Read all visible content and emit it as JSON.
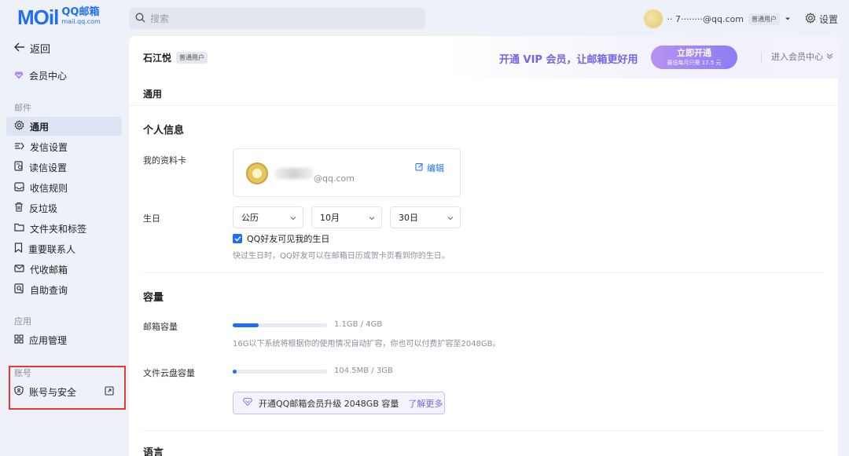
{
  "brand": {
    "wordmark": "MOil",
    "name_cn": "QQ邮箱",
    "domain": "mail.qq.com"
  },
  "search": {
    "placeholder": "搜索"
  },
  "user": {
    "email": "·· 7········@qq.com",
    "badge": "普通用户",
    "settings_label": "设置"
  },
  "sidebar": {
    "back_label": "返回",
    "vip_center_label": "会员中心",
    "section_mail": "邮件",
    "mail_items": [
      {
        "label": "通用",
        "icon": "gear-icon",
        "active": true
      },
      {
        "label": "发信设置",
        "icon": "compose-icon",
        "active": false
      },
      {
        "label": "读信设置",
        "icon": "read-icon",
        "active": false
      },
      {
        "label": "收信规则",
        "icon": "inbox-icon",
        "active": false
      },
      {
        "label": "反垃圾",
        "icon": "trash-icon",
        "active": false
      },
      {
        "label": "文件夹和标签",
        "icon": "folder-icon",
        "active": false
      },
      {
        "label": "重要联系人",
        "icon": "bookmark-icon",
        "active": false
      },
      {
        "label": "代收邮箱",
        "icon": "collect-icon",
        "active": false
      },
      {
        "label": "自助查询",
        "icon": "query-icon",
        "active": false
      }
    ],
    "section_apps": "应用",
    "apps_item": {
      "label": "应用管理",
      "icon": "grid-icon"
    },
    "section_account": "账号",
    "account_item": {
      "label": "账号与安全",
      "icon": "shield-icon"
    }
  },
  "header": {
    "username": "石江悦",
    "user_badge": "普通用户",
    "vip_pitch": "开通 VIP 会员，让邮箱更好用",
    "vip_button_main": "立即开通",
    "vip_button_sub": "最低每月只需 17.5 元",
    "enter_vip_label": "进入会员中心"
  },
  "main": {
    "title": "通用",
    "personal_info_title": "个人信息",
    "profile_card_label": "我的资料卡",
    "profile_card_email": "@qq.com",
    "edit_label": "编辑",
    "birthday_label": "生日",
    "birthday_calendar": "公历",
    "birthday_month": "10月",
    "birthday_day": "30日",
    "birthday_visible_label": "QQ好友可见我的生日",
    "birthday_hint": "快过生日时，QQ好友可以在邮箱日历或贺卡页看到你的生日。",
    "capacity_title": "容量",
    "mailbox_capacity_label": "邮箱容量",
    "mailbox_capacity_text": "1.1GB / 4GB",
    "mailbox_capacity_fraction": 0.275,
    "mailbox_capacity_hint": "16G以下系统将根据你的使用情况自动扩容，你也可以付费扩容至2048GB。",
    "cloud_capacity_label": "文件云盘容量",
    "cloud_capacity_text": "104.5MB / 3GB",
    "cloud_capacity_fraction": 0.034,
    "upgrade_text": "开通QQ邮箱会员升级 2048GB 容量",
    "upgrade_more": "了解更多",
    "language_title": "语言"
  },
  "colors": {
    "accent": "#1f6ef5",
    "vip": "#6f67e8",
    "highlight": "#e53935"
  }
}
